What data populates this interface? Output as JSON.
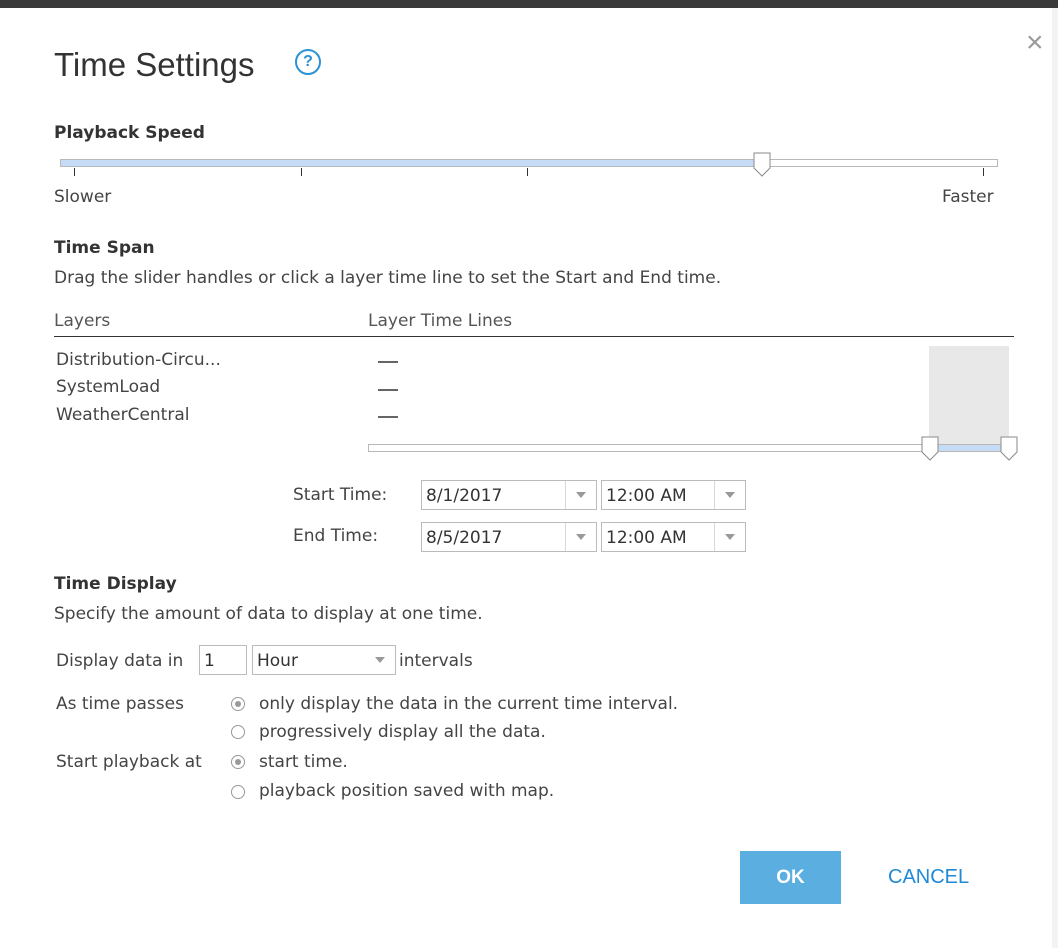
{
  "dialog": {
    "title": "Time Settings",
    "help_glyph": "?",
    "close_glyph": "×"
  },
  "playback_speed": {
    "heading": "Playback Speed",
    "min_label": "Slower",
    "max_label": "Faster",
    "value_fraction": 0.75
  },
  "time_span": {
    "heading": "Time Span",
    "description": "Drag the slider handles or click a layer time line to set the Start and End time.",
    "col_layers": "Layers",
    "col_timelines": "Layer Time Lines",
    "layers": [
      "Distribution-Circu...",
      "SystemLoad",
      "WeatherCentral"
    ],
    "range_start_fraction": 0.875,
    "range_end_fraction": 1.0,
    "start_label": "Start Time:",
    "start_date": "8/1/2017",
    "start_time": "12:00 AM",
    "end_label": "End Time:",
    "end_date": "8/5/2017",
    "end_time": "12:00 AM"
  },
  "time_display": {
    "heading": "Time Display",
    "description": "Specify the amount of data to display at one time.",
    "display_prefix": "Display data in",
    "interval_value": "1",
    "interval_unit": "Hour",
    "display_suffix": "intervals",
    "as_time_passes_label": "As time passes",
    "option_current": "only display the data in the current time interval.",
    "option_progressive": "progressively display all the data.",
    "start_playback_label": "Start playback at",
    "option_start_time": "start time.",
    "option_saved_position": "playback position saved with map."
  },
  "buttons": {
    "ok": "OK",
    "cancel": "CANCEL"
  },
  "colors": {
    "accent": "#5aaee0",
    "link": "#1f8ad6",
    "slider_fill": "#c6dbf5"
  }
}
